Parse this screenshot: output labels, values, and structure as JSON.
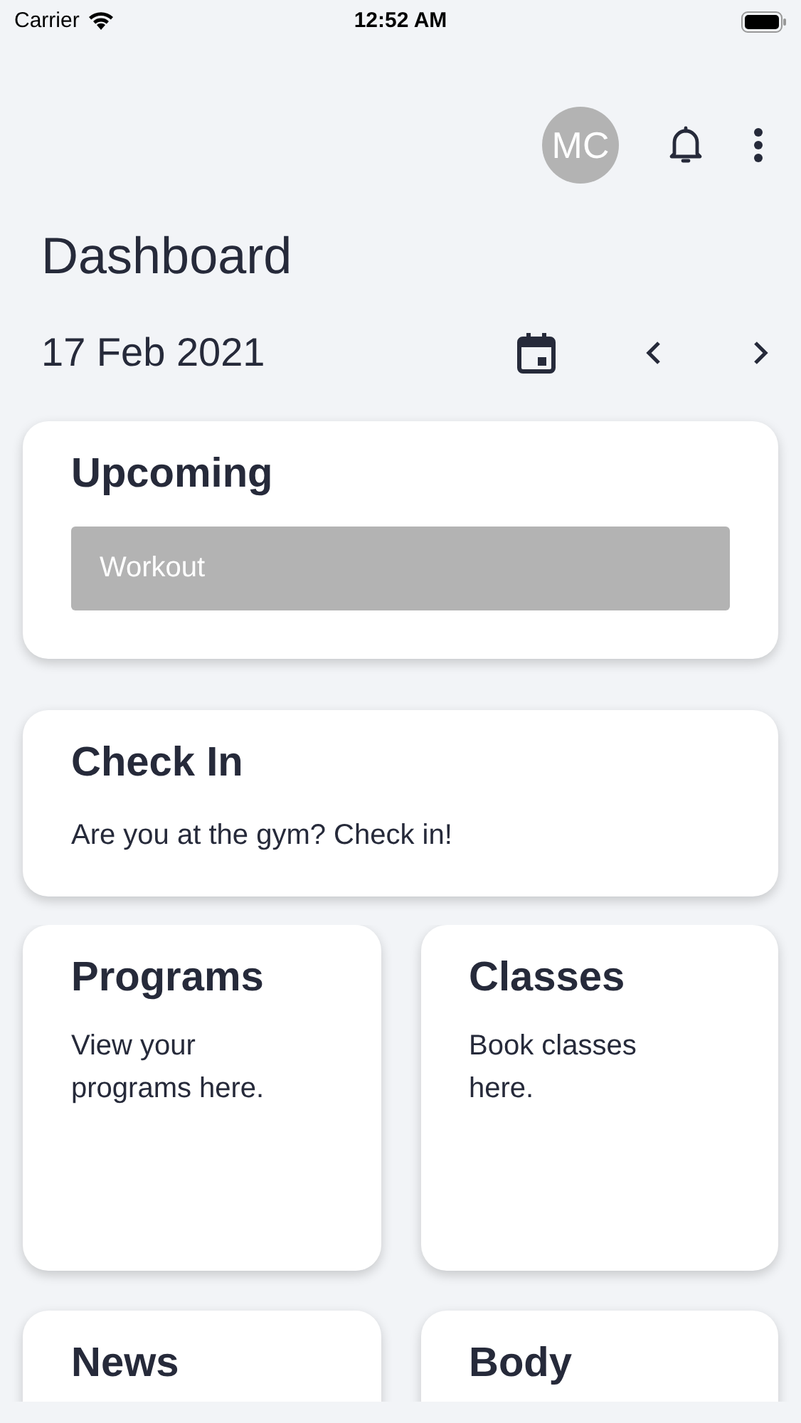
{
  "status_bar": {
    "carrier": "Carrier",
    "time": "12:52 AM"
  },
  "header": {
    "avatar": "MC"
  },
  "title": "Dashboard",
  "date": "17 Feb 2021",
  "upcoming": {
    "title": "Upcoming",
    "items": [
      "Workout"
    ]
  },
  "check_in": {
    "title": "Check In",
    "text": "Are you at the gym? Check in!"
  },
  "tiles": [
    {
      "title": "Programs",
      "text": "View your programs here."
    },
    {
      "title": "Classes",
      "text": "Book classes here."
    },
    {
      "title": "News"
    },
    {
      "title": "Body"
    }
  ]
}
